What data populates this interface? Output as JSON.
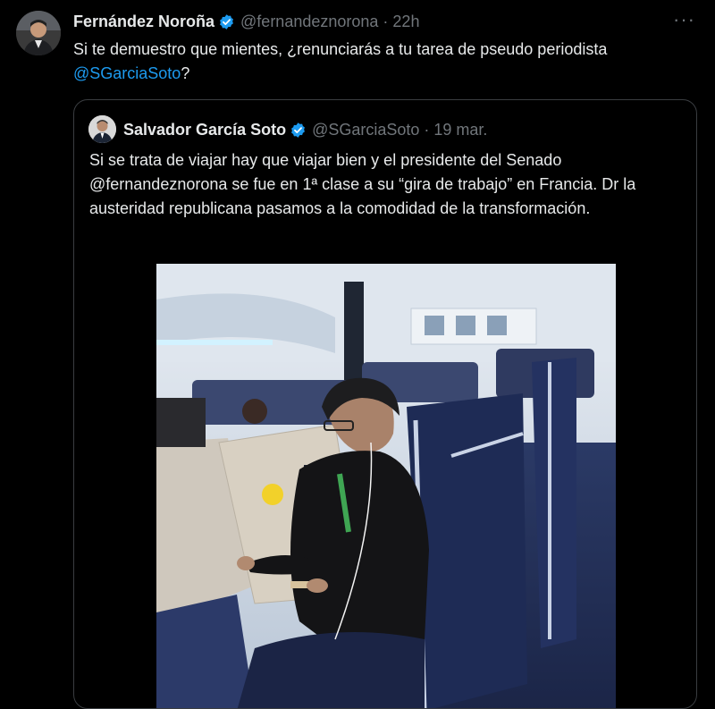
{
  "tweet": {
    "author_name": "Fernández Noroña",
    "handle": "@fernandeznorona",
    "time": "22h",
    "more_label": "···",
    "text": "Si te demuestro que mientes, ¿renunciarás a tu tarea de pseudo periodista",
    "mention": "@SGarciaSoto",
    "text_end": "?"
  },
  "quote": {
    "author_name": "Salvador García Soto",
    "handle": "@SGarciaSoto",
    "date": "19 mar.",
    "text": "Si se trata de viajar hay que viajar bien y el presidente del Senado @fernandeznorona se fue en 1ª clase a su “gira de trabajo” en Francia. Dr la austeridad republicana pasamos a la comodidad de la transformación."
  },
  "colors": {
    "background": "#000000",
    "text": "#e7e9ea",
    "secondary": "#71767b",
    "link": "#1d9bf0",
    "verified": "#1d9bf0",
    "border": "#3a3d41"
  },
  "icons": {
    "verified": "verified-badge-icon",
    "more": "more-horizontal-icon"
  }
}
